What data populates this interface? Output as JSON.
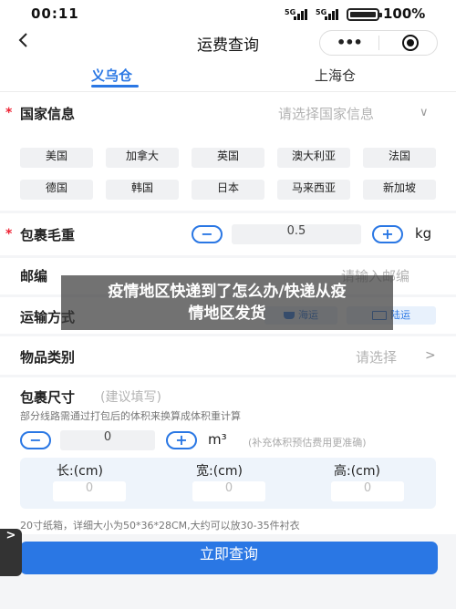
{
  "status_bar": {
    "time": "00:11",
    "signal1": "5G",
    "signal2": "5G",
    "battery": "100%"
  },
  "nav": {
    "back_icon": "chevron-left-icon",
    "title": "运费查询"
  },
  "capsule": {
    "more_icon": "more-dots-icon",
    "more": "•••",
    "close_icon": "target-icon"
  },
  "tabs": [
    {
      "label": "义乌仓",
      "active": true
    },
    {
      "label": "上海仓",
      "active": false
    }
  ],
  "country": {
    "required": "*",
    "label": "国家信息",
    "placeholder": "请选择国家信息",
    "chevron": "∨"
  },
  "countries": [
    "美国",
    "加拿大",
    "英国",
    "澳大利亚",
    "法国",
    "德国",
    "韩国",
    "日本",
    "马来西亚",
    "新加坡"
  ],
  "weight": {
    "required": "*",
    "label": "包裹毛重",
    "minus": "−",
    "value": "0.5",
    "plus": "+",
    "unit": "kg"
  },
  "postcode": {
    "label": "邮编",
    "placeholder": "请输入邮编"
  },
  "shipping": {
    "label": "运输方式",
    "options": [
      {
        "icon": "ship-icon",
        "label": "海运"
      },
      {
        "icon": "truck-icon",
        "label": "陆运"
      }
    ]
  },
  "category": {
    "label": "物品类别",
    "placeholder": "请选择",
    "chevron": ">"
  },
  "size": {
    "label": "包裹尺寸",
    "sub": "(建议填写)",
    "note": "部分线路需通过打包后的体积来换算成体积重计算",
    "minus": "−",
    "value": "0",
    "plus": "+",
    "unit": "m³",
    "unit_note": "(补充体积预估费用更准确)",
    "dims": [
      {
        "label": "长:(cm)",
        "value": "0"
      },
      {
        "label": "宽:(cm)",
        "value": "0"
      },
      {
        "label": "高:(cm)",
        "value": "0"
      }
    ],
    "footnote": "20寸纸箱，详细大小为50*36*28CM,大约可以放30-35件衬衣"
  },
  "submit": {
    "label": "立即查询"
  },
  "side_tab": {
    "label": ">"
  },
  "overlay": {
    "line1": "疫情地区快递到了怎么办/快递从疫",
    "line2": "情地区发货"
  },
  "colors": {
    "accent": "#2a77e4",
    "required": "#ee2233",
    "overlay": "#3c3c3c"
  }
}
